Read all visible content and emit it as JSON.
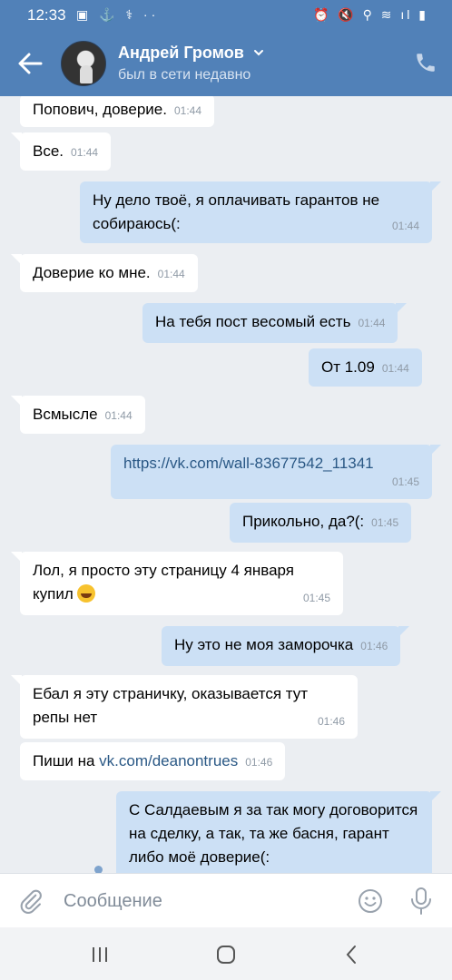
{
  "status_bar": {
    "time": "12:33",
    "left_icons": "▣ ⚓ ⚕ ··",
    "right_icons": "⏰ 🔇 ⚲ ≋ ıl ▮"
  },
  "header": {
    "name": "Андрей Громов",
    "status": "был в сети недавно"
  },
  "messages": [
    {
      "dir": "in",
      "text": "Попович, доверие.",
      "time": "01:44"
    },
    {
      "dir": "in",
      "text": "Все.",
      "time": "01:44"
    },
    {
      "dir": "out",
      "text": "Ну дело твоё, я оплачивать гарантов не собираюсь(:",
      "time": "01:44"
    },
    {
      "dir": "in",
      "text": "Доверие ко мне.",
      "time": "01:44"
    },
    {
      "dir": "out",
      "text": "На тебя пост весомый есть",
      "time": "01:44"
    },
    {
      "dir": "out",
      "text": "От 1.09",
      "time": "01:44"
    },
    {
      "dir": "in",
      "text": "Всмысле",
      "time": "01:44"
    },
    {
      "dir": "out",
      "text": "https://vk.com/wall-83677542_11341",
      "time": "01:45"
    },
    {
      "dir": "out",
      "text": "Прикольно, да?(:",
      "time": "01:45"
    },
    {
      "dir": "in",
      "text": "Лол, я просто эту страницу 4 января купил",
      "time": "01:45"
    },
    {
      "dir": "out",
      "text": "Ну это не моя заморочка",
      "time": "01:46"
    },
    {
      "dir": "in",
      "text": "Ебал я эту страничку, оказывается тут репы нет",
      "time": "01:46"
    },
    {
      "dir": "in",
      "text_prefix": "Пиши на ",
      "link": "vk.com/deanontrues",
      "time": "01:46"
    },
    {
      "dir": "out",
      "text": "С Салдаевым я за так могу договорится на сделку, а так, та же басня, гарант либо моё доверие(:",
      "time": ""
    }
  ],
  "input": {
    "placeholder": "Сообщение"
  },
  "colors": {
    "header": "#5181b8",
    "outgoing": "#cce0f5",
    "incoming": "#ffffff",
    "background": "#ebeef2",
    "link": "#2a5885"
  }
}
